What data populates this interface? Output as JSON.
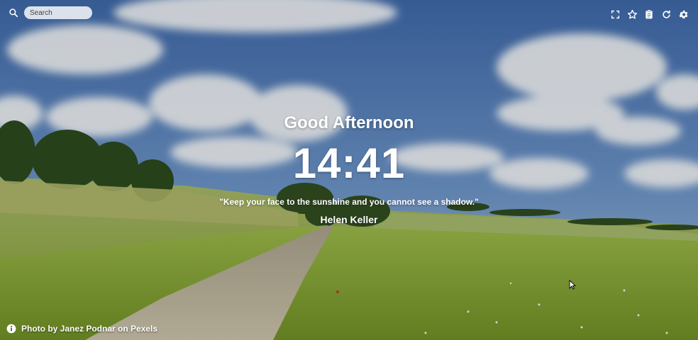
{
  "search": {
    "placeholder": "Search",
    "icon": "search-icon"
  },
  "toolbar": {
    "icons": [
      "fullscreen-icon",
      "star-icon",
      "clipboard-icon",
      "refresh-icon",
      "gear-icon"
    ]
  },
  "main": {
    "greeting": "Good Afternoon",
    "time": "14:41",
    "quote": "\"Keep your face to the sunshine and you cannot see a shadow.\"",
    "author": "Helen Keller"
  },
  "footer": {
    "icon": "info-icon",
    "credit": "Photo by Janez Podnar on Pexels"
  },
  "colors": {
    "sky": "#4f79b8",
    "grass": "#8fae3a",
    "path": "#b9b29e",
    "text": "#ffffff"
  }
}
